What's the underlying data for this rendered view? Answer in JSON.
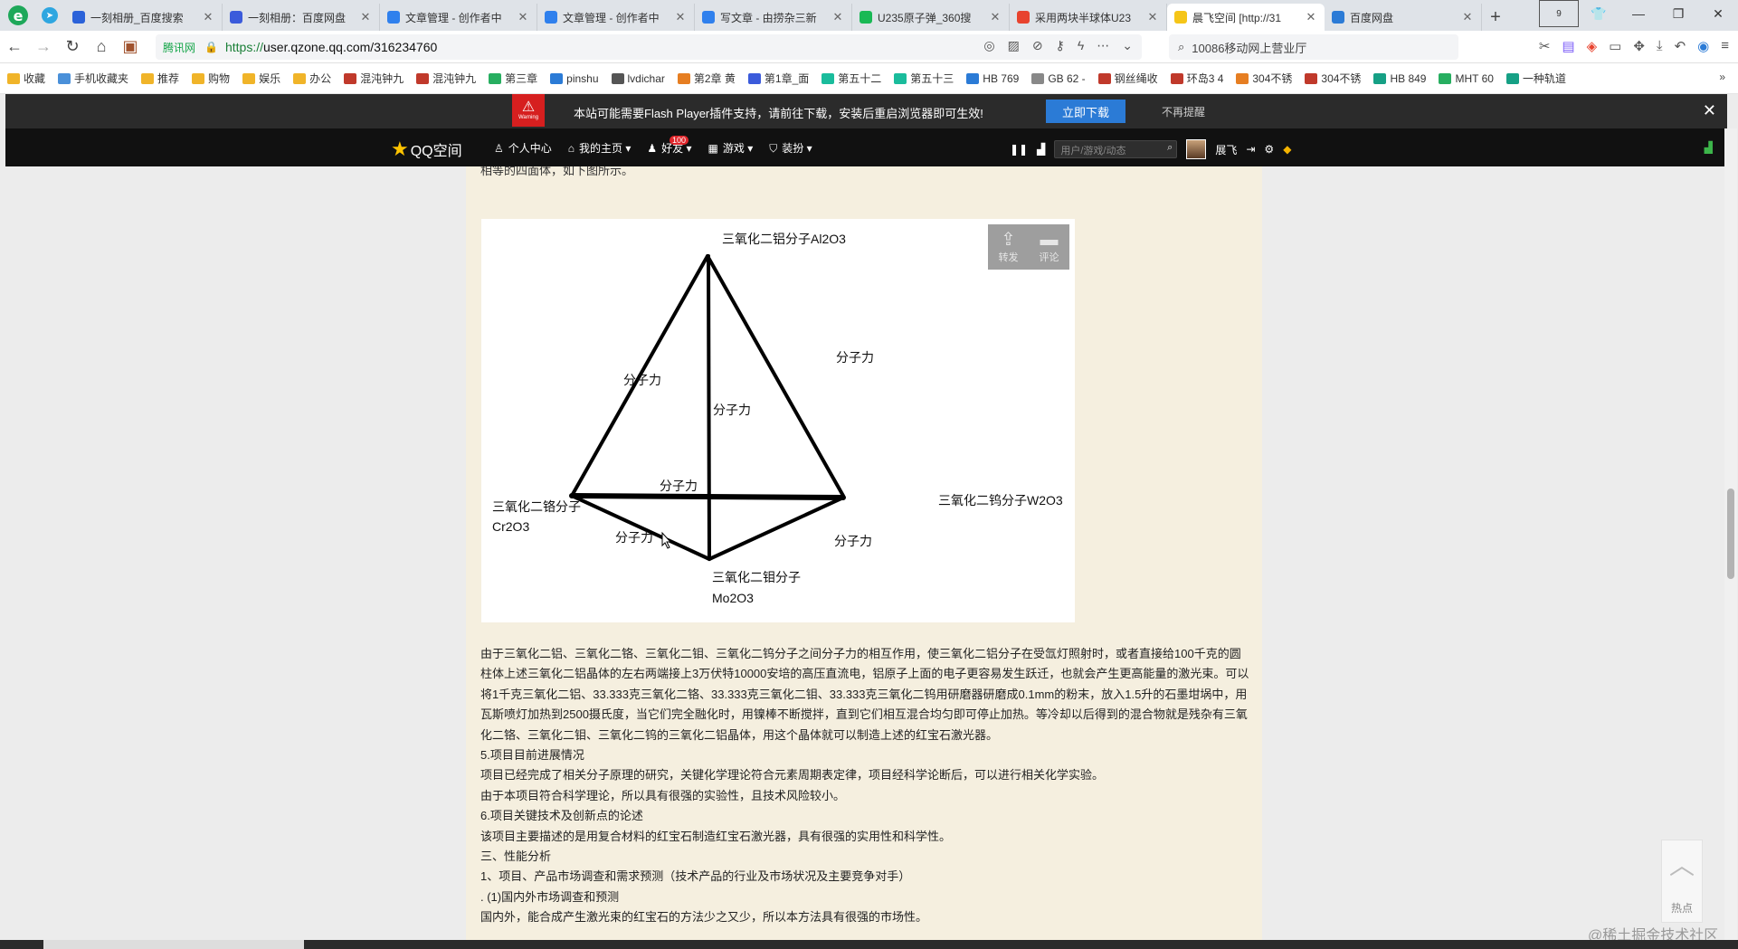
{
  "tabs": [
    {
      "title": "一刻相册_百度搜索",
      "fav": "#2b62d9"
    },
    {
      "title": "一刻相册：百度网盘",
      "fav": "#3b5bdb"
    },
    {
      "title": "文章管理 - 创作者中",
      "fav": "#2f80ed"
    },
    {
      "title": "文章管理 - 创作者中",
      "fav": "#2f80ed"
    },
    {
      "title": "写文章 - 由捞杂三新",
      "fav": "#2f80ed"
    },
    {
      "title": "U235原子弹_360搜",
      "fav": "#19b955"
    },
    {
      "title": "采用两块半球体U23",
      "fav": "#e8432e"
    },
    {
      "title": "晨飞空间 [http://31",
      "fav": "#f5c518"
    },
    {
      "title": "百度网盘",
      "fav": "#2b7bd6"
    }
  ],
  "tab_count_badge": "9",
  "address": {
    "site_label": "腾讯网",
    "url_prefix": "https://",
    "url_host": "user.qzone.qq.com",
    "url_path": "/316234760"
  },
  "search": {
    "text": "10086移动网上营业厅"
  },
  "bookmarks": [
    "收藏",
    "手机收藏夹",
    "推荐",
    "购物",
    "娱乐",
    "办公",
    "混沌钟九",
    "混沌钟九",
    "第三章",
    "pinshu",
    "lvdichar",
    "第2章 黄",
    "第1章_面",
    "第五十二",
    "第五十三",
    "HB 769",
    "GB 62 -",
    "钢丝绳收",
    "环岛3 4",
    "304不锈",
    "304不锈",
    "HB 849",
    "MHT 60",
    "一种轨道"
  ],
  "flash": {
    "warning": "Warning",
    "message": "本站可能需要Flash Player插件支持，请前往下载，安装后重启浏览器即可生效!",
    "download": "立即下载",
    "dismiss": "不再提醒"
  },
  "qzone": {
    "logo": "QQ空间",
    "nav": [
      "个人中心",
      "我的主页",
      "好友",
      "游戏",
      "装扮"
    ],
    "friends_badge": "100",
    "search_placeholder": "用户/游戏/动态",
    "username": "展飞"
  },
  "article": {
    "top_text": "相等的四面体，如下图所示。",
    "share": "转发",
    "comment": "评论",
    "diagram": {
      "top": "三氧化二铝分子Al2O3",
      "left_line1": "三氧化二铬分子",
      "left_line2": "Cr2O3",
      "right": "三氧化二钨分子W2O3",
      "bottom_line1": "三氧化二钼分子",
      "bottom_line2": "Mo2O3",
      "force": "分子力"
    },
    "paragraphs": [
      "由于三氧化二铝、三氧化二铬、三氧化二钼、三氧化二钨分子之间分子力的相互作用，使三氧化二铝分子在受氙灯照射时，或者直接给100千克的圆柱体上述三氧化二铝晶体的左右两端接上3万伏特10000安培的高压直流电，铝原子上面的电子更容易发生跃迁，也就会产生更高能量的激光束。可以将1千克三氧化二铝、33.333克三氧化二铬、33.333克三氧化二钼、33.333克三氧化二钨用研磨器研磨成0.1mm的粉末，放入1.5升的石墨坩埚中，用瓦斯喷灯加热到2500摄氏度，当它们完全融化时，用镍棒不断搅拌，直到它们相互混合均匀即可停止加热。等冷却以后得到的混合物就是残杂有三氧化二铬、三氧化二钼、三氧化二钨的三氧化二铝晶体，用这个晶体就可以制造上述的红宝石激光器。",
      "5.项目目前进展情况",
      "项目已经完成了相关分子原理的研究，关键化学理论符合元素周期表定律，项目经科学论断后，可以进行相关化学实验。",
      "由于本项目符合科学理论，所以具有很强的实验性，且技术风险较小。",
      "6.项目关键技术及创新点的论述",
      "该项目主要描述的是用复合材料的红宝石制造红宝石激光器，具有很强的实用性和科学性。",
      "三、性能分析",
      "1、项目、产品市场调查和需求预测（技术产品的行业及市场状况及主要竞争对手）",
      ". (1)国内外市场调查和预测",
      "国内外，能合成产生激光束的红宝石的方法少之又少，所以本方法具有很强的市场性。"
    ]
  },
  "to_top": {
    "hot": "热点"
  },
  "watermark": "@稀土掘金技术社区"
}
